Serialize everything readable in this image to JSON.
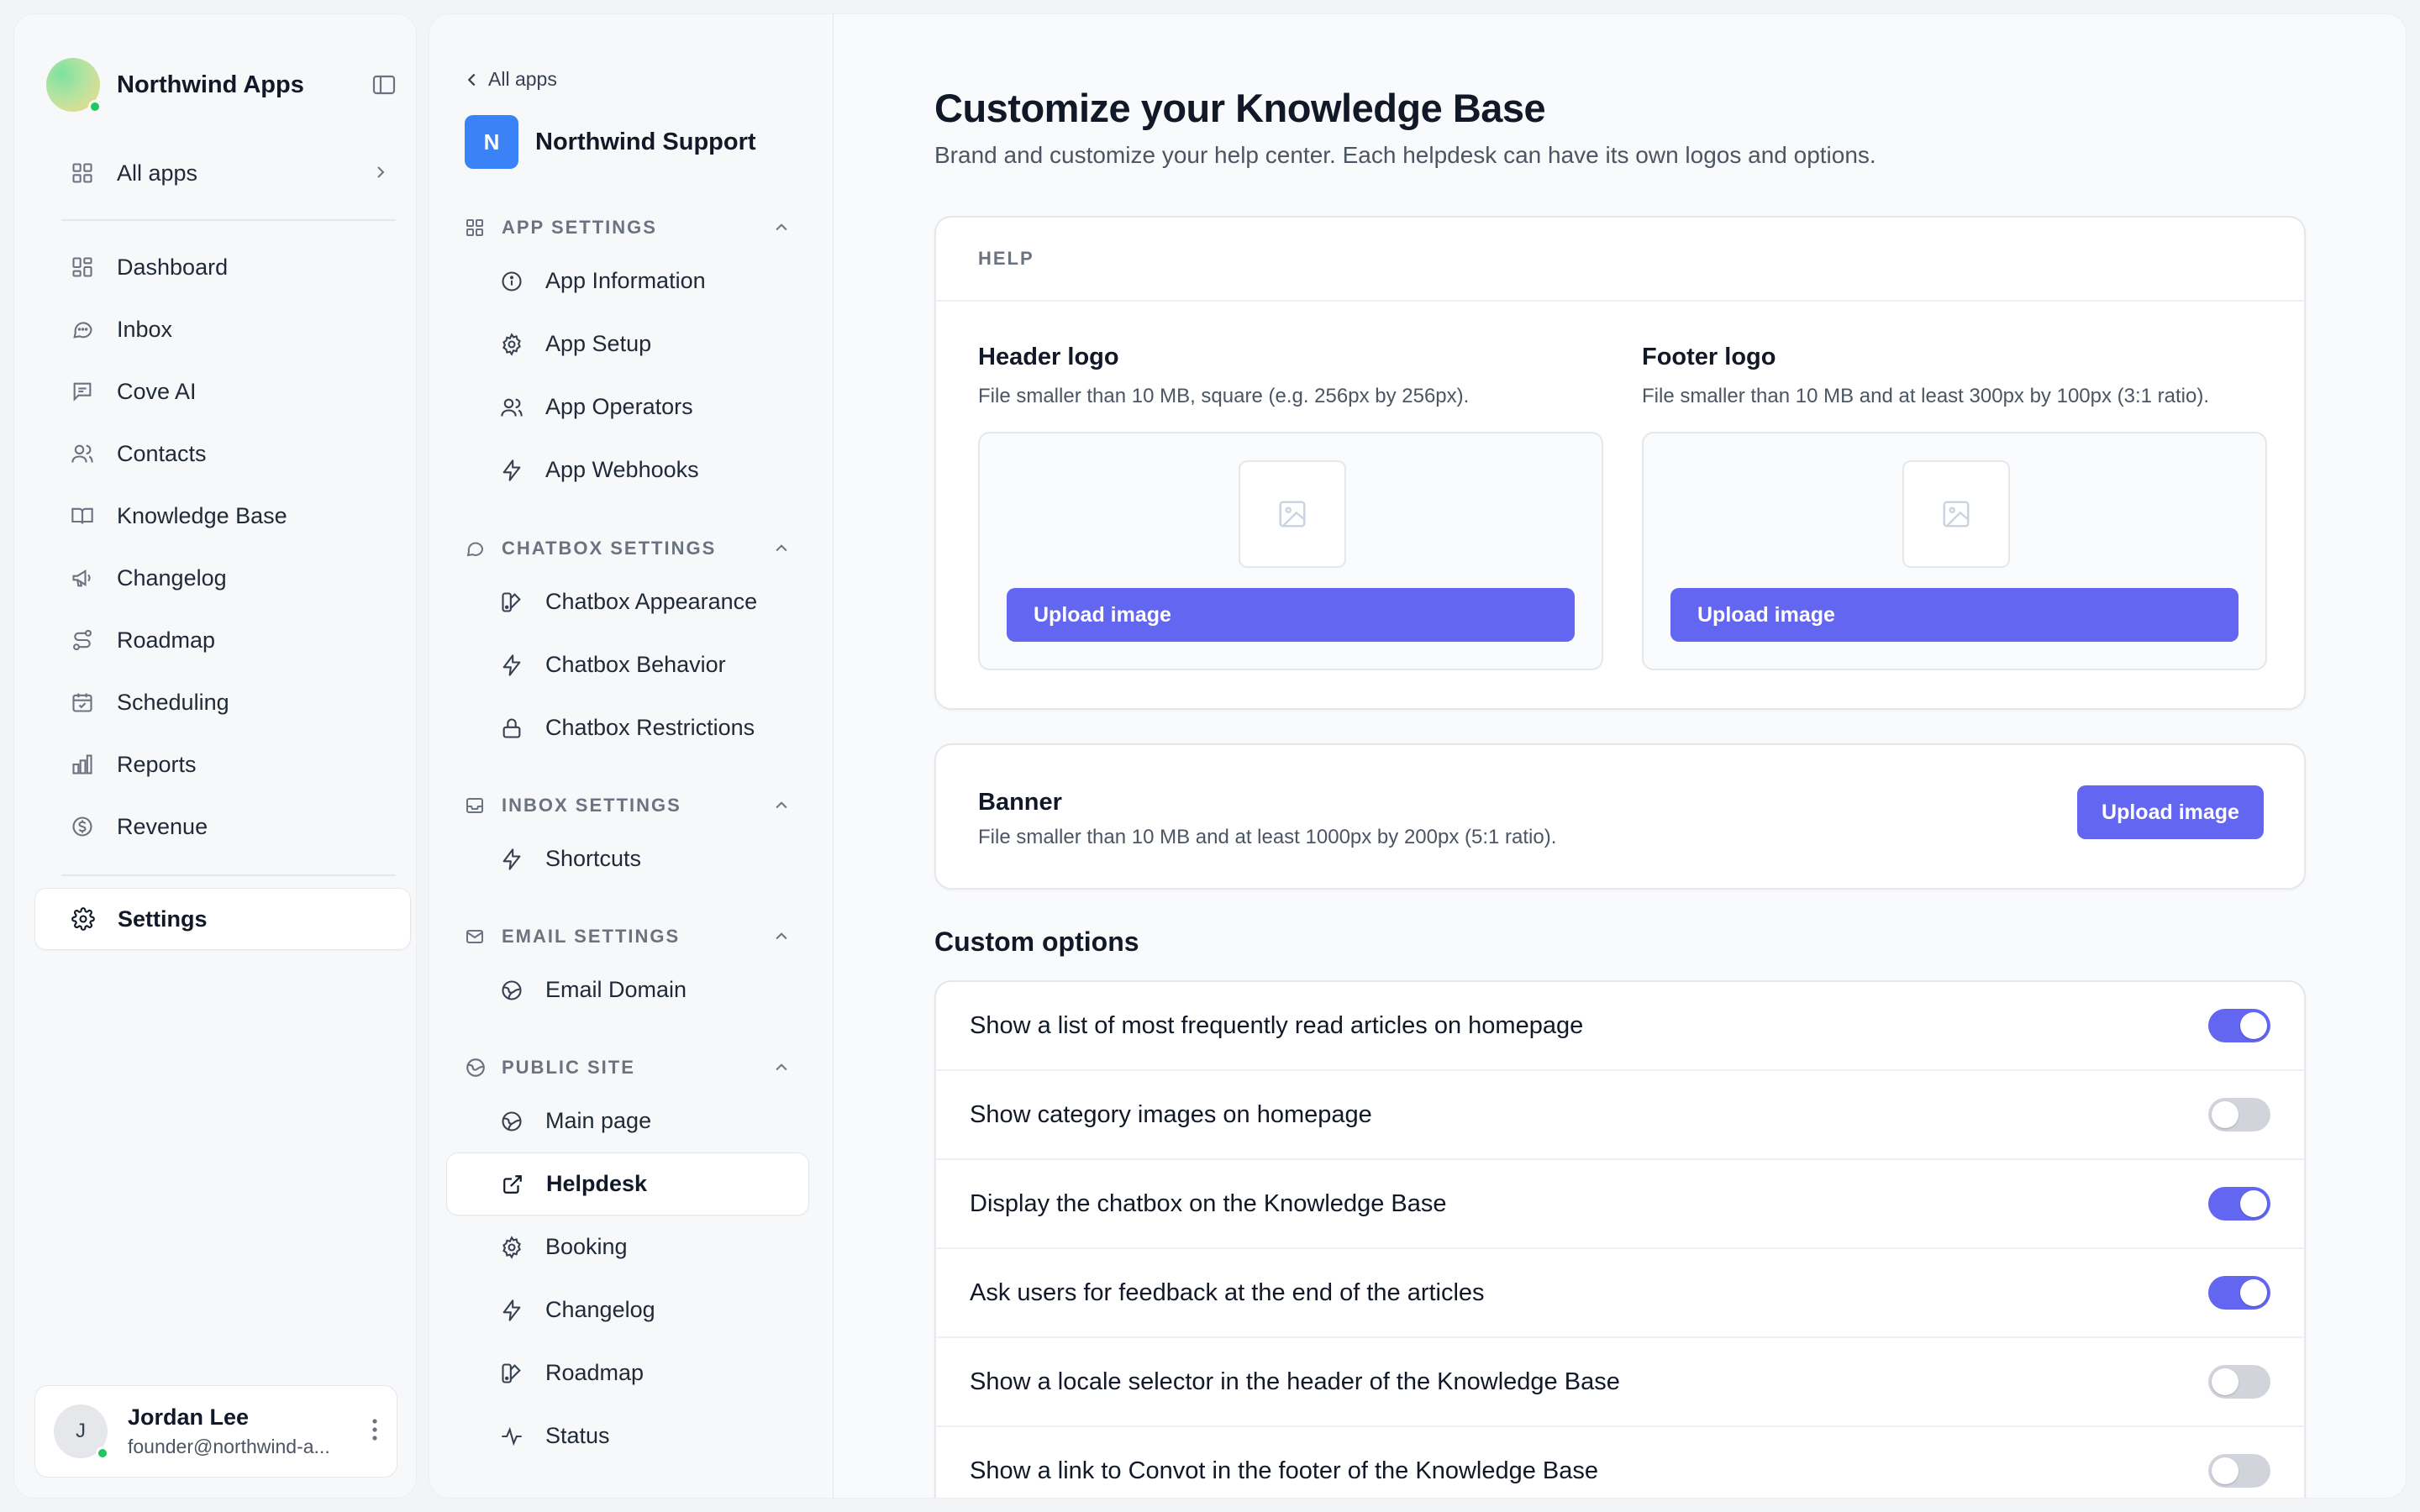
{
  "brand": {
    "name": "Northwind Apps"
  },
  "nav": {
    "all_apps": "All apps",
    "items": [
      {
        "label": "Dashboard",
        "icon": "grid-icon"
      },
      {
        "label": "Inbox",
        "icon": "chat-bubble-icon"
      },
      {
        "label": "Cove AI",
        "icon": "message-square-icon"
      },
      {
        "label": "Contacts",
        "icon": "users-icon"
      },
      {
        "label": "Knowledge Base",
        "icon": "book-open-icon"
      },
      {
        "label": "Changelog",
        "icon": "megaphone-icon"
      },
      {
        "label": "Roadmap",
        "icon": "route-icon"
      },
      {
        "label": "Scheduling",
        "icon": "calendar-icon"
      },
      {
        "label": "Reports",
        "icon": "bar-chart-icon"
      },
      {
        "label": "Revenue",
        "icon": "dollar-circle-icon"
      }
    ],
    "settings": "Settings"
  },
  "user": {
    "initial": "J",
    "name": "Jordan Lee",
    "email": "founder@northwind-a..."
  },
  "panel": {
    "back": "All apps",
    "app_initial": "N",
    "app_name": "Northwind Support",
    "sections": {
      "app_settings": {
        "title": "APP SETTINGS",
        "items": [
          "App Information",
          "App Setup",
          "App Operators",
          "App Webhooks"
        ]
      },
      "chatbox_settings": {
        "title": "CHATBOX SETTINGS",
        "items": [
          "Chatbox Appearance",
          "Chatbox Behavior",
          "Chatbox Restrictions"
        ]
      },
      "inbox_settings": {
        "title": "INBOX SETTINGS",
        "items": [
          "Shortcuts"
        ]
      },
      "email_settings": {
        "title": "EMAIL SETTINGS",
        "items": [
          "Email Domain"
        ]
      },
      "public_site": {
        "title": "PUBLIC SITE",
        "items": [
          "Main page",
          "Helpdesk",
          "Booking",
          "Changelog",
          "Roadmap",
          "Status"
        ]
      }
    }
  },
  "main": {
    "title": "Customize your Knowledge Base",
    "subtitle": "Brand and customize your help center. Each helpdesk can have its own logos and options.",
    "help_label": "HELP",
    "header_logo": {
      "title": "Header logo",
      "desc": "File smaller than 10 MB, square (e.g. 256px by 256px).",
      "button": "Upload image"
    },
    "footer_logo": {
      "title": "Footer logo",
      "desc": "File smaller than 10 MB and at least 300px by 100px (3:1 ratio).",
      "button": "Upload image"
    },
    "banner": {
      "title": "Banner",
      "desc": "File smaller than 10 MB and at least 1000px by 200px (5:1 ratio).",
      "button": "Upload image"
    },
    "custom_options_title": "Custom options",
    "options": [
      {
        "label": "Show a list of most frequently read articles on homepage",
        "enabled": true
      },
      {
        "label": "Show category images on homepage",
        "enabled": false
      },
      {
        "label": "Display the chatbox on the Knowledge Base",
        "enabled": true
      },
      {
        "label": "Ask users for feedback at the end of the articles",
        "enabled": true
      },
      {
        "label": "Show a locale selector in the header of the Knowledge Base",
        "enabled": false
      },
      {
        "label": "Show a link to Convot in the footer of the Knowledge Base",
        "enabled": false
      }
    ]
  },
  "colors": {
    "accent": "#6366f1",
    "online": "#22c55e",
    "app_badge": "#3b82f6"
  }
}
